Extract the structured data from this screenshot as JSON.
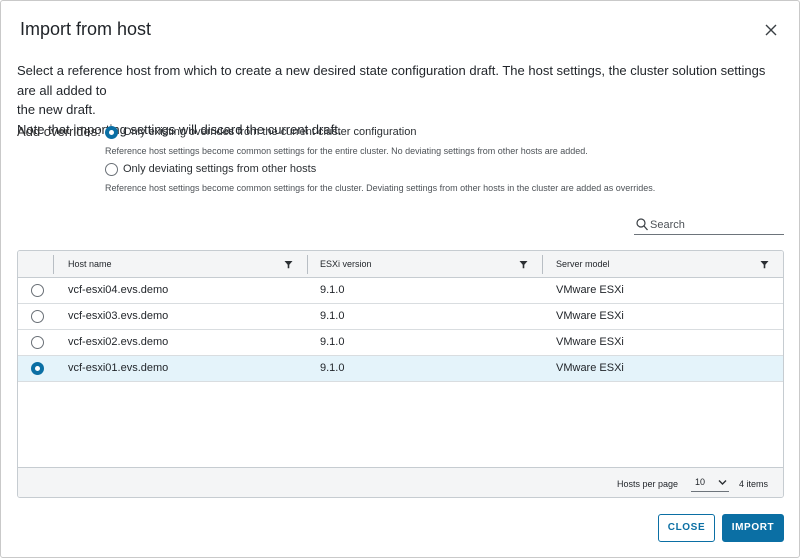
{
  "dialog": {
    "title": "Import from host",
    "description_line1": "Select a reference host from which to create a new desired state configuration draft. The host settings, the cluster solution settings are all added to",
    "description_line2": "the new draft.",
    "note": "Note that importing settings will discard the current draft."
  },
  "overrides": {
    "label": "Add overrides:",
    "options": [
      {
        "label": "Only existing overrides from the current cluster configuration",
        "description": "Reference host settings become common settings for the entire cluster. No deviating settings from other hosts are added.",
        "selected": true
      },
      {
        "label": "Only deviating settings from other hosts",
        "description": "Reference host settings become common settings for the cluster. Deviating settings from other hosts in the cluster are added as overrides.",
        "selected": false
      }
    ]
  },
  "search": {
    "placeholder": "Search",
    "value": ""
  },
  "grid": {
    "columns": [
      "Host name",
      "ESXi version",
      "Server model"
    ],
    "rows": [
      {
        "host": "vcf-esxi04.evs.demo",
        "version": "9.1.0",
        "model": "VMware ESXi",
        "selected": false
      },
      {
        "host": "vcf-esxi03.evs.demo",
        "version": "9.1.0",
        "model": "VMware ESXi",
        "selected": false
      },
      {
        "host": "vcf-esxi02.evs.demo",
        "version": "9.1.0",
        "model": "VMware ESXi",
        "selected": false
      },
      {
        "host": "vcf-esxi01.evs.demo",
        "version": "9.1.0",
        "model": "VMware ESXi",
        "selected": true
      }
    ],
    "footer": {
      "hosts_per_page_label": "Hosts per page",
      "hosts_per_page_value": "10",
      "items_count": "4 items"
    }
  },
  "buttons": {
    "close": "CLOSE",
    "import": "IMPORT"
  },
  "colors": {
    "accent": "#0b6fa4",
    "selected_row": "#e4f3fa",
    "header_bg": "#f4f5f6"
  }
}
